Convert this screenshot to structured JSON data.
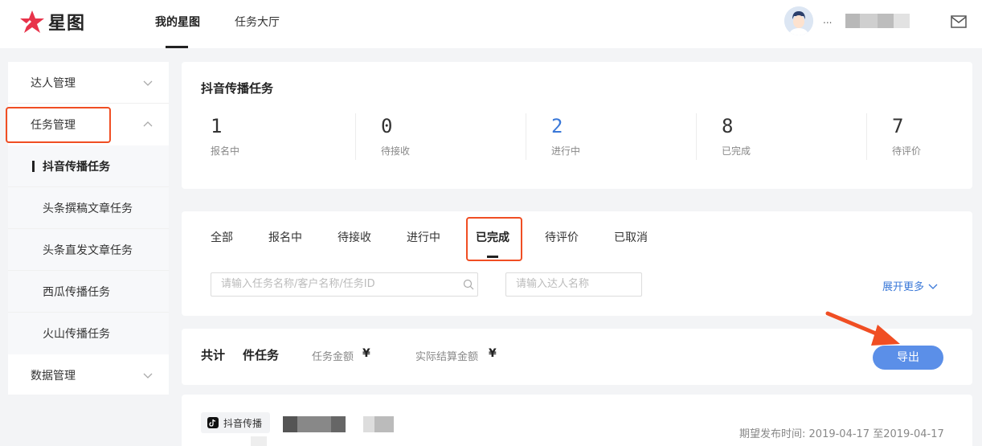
{
  "header": {
    "logo_text": "星图",
    "nav": [
      "我的星图",
      "任务大厅"
    ],
    "username": "..."
  },
  "sidebar": {
    "items": [
      {
        "label": "达人管理",
        "chevron": "down"
      },
      {
        "label": "任务管理",
        "chevron": "up"
      },
      {
        "label": "抖音传播任务",
        "sub": true,
        "active": true
      },
      {
        "label": "头条撰稿文章任务",
        "sub": true
      },
      {
        "label": "头条直发文章任务",
        "sub": true
      },
      {
        "label": "西瓜传播任务",
        "sub": true
      },
      {
        "label": "火山传播任务",
        "sub": true
      },
      {
        "label": "数据管理",
        "chevron": "down"
      }
    ]
  },
  "overview": {
    "title": "抖音传播任务",
    "stats": [
      {
        "value": "1",
        "label": "报名中"
      },
      {
        "value": "0",
        "label": "待接收"
      },
      {
        "value": "2",
        "label": "进行中"
      },
      {
        "value": "8",
        "label": "已完成"
      },
      {
        "value": "7",
        "label": "待评价"
      }
    ]
  },
  "filters": {
    "tabs": [
      "全部",
      "报名中",
      "待接收",
      "进行中",
      "已完成",
      "待评价",
      "已取消"
    ],
    "active_tab": "已完成",
    "search_placeholder": "请输入任务名称/客户名称/任务ID",
    "talent_placeholder": "请输入达人名称",
    "expand_label": "展开更多"
  },
  "summary": {
    "total_prefix": "共计",
    "total_suffix": "件任务",
    "amount_label": "任务金额",
    "amount_value": "¥",
    "settle_label": "实际结算金额",
    "settle_value": "¥",
    "export_label": "导出"
  },
  "task": {
    "platform_tag": "抖音传播",
    "date_label": "期望发布时间:",
    "date_value": "2019-04-17 至2019-04-17"
  },
  "colors": {
    "accent": "#3a78d8",
    "export_button": "#5b8fe8",
    "highlight": "#f04e23",
    "logo": "#e8334a"
  }
}
